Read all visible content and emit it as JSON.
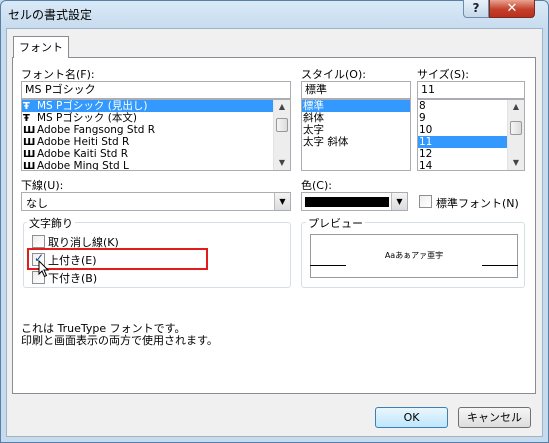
{
  "window": {
    "title": "セルの書式設定",
    "help_label": "?",
    "close_label": "✕"
  },
  "tabs": [
    {
      "label": "フォント"
    }
  ],
  "font_name": {
    "label": "フォント名(F):",
    "value": "MS Pゴシック",
    "items": [
      {
        "label": "MS Pゴシック (見出し)",
        "icon": "truetype-icon",
        "glyph": "Ŧ",
        "selected": true
      },
      {
        "label": "MS Pゴシック (本文)",
        "icon": "truetype-icon",
        "glyph": "Ŧ",
        "selected": false
      },
      {
        "label": "Adobe Fangsong Std R",
        "icon": "opentype-font-icon",
        "glyph": "Ш",
        "selected": false
      },
      {
        "label": "Adobe Heiti Std R",
        "icon": "opentype-font-icon",
        "glyph": "Ш",
        "selected": false
      },
      {
        "label": "Adobe Kaiti Std R",
        "icon": "opentype-font-icon",
        "glyph": "Ш",
        "selected": false
      },
      {
        "label": "Adobe Ming Std L",
        "icon": "opentype-font-icon",
        "glyph": "Ш",
        "selected": false
      }
    ]
  },
  "font_style": {
    "label": "スタイル(O):",
    "value": "標準",
    "items": [
      {
        "label": "標準",
        "selected": true
      },
      {
        "label": "斜体",
        "selected": false
      },
      {
        "label": "太字",
        "selected": false
      },
      {
        "label": "太字 斜体",
        "selected": false
      }
    ]
  },
  "font_size": {
    "label": "サイズ(S):",
    "value": "11",
    "items": [
      {
        "label": "8",
        "selected": false
      },
      {
        "label": "9",
        "selected": false
      },
      {
        "label": "10",
        "selected": false
      },
      {
        "label": "11",
        "selected": true
      },
      {
        "label": "12",
        "selected": false
      },
      {
        "label": "14",
        "selected": false
      }
    ]
  },
  "underline": {
    "label": "下線(U):",
    "value": "なし"
  },
  "color": {
    "label": "色(C):",
    "swatch": "#000000"
  },
  "normal_font": {
    "label": "標準フォント(N)",
    "checked": false
  },
  "effects": {
    "title": "文字飾り",
    "strikethrough": {
      "label": "取り消し線(K)",
      "checked": false
    },
    "superscript": {
      "label": "上付き(E)",
      "checked": true
    },
    "subscript": {
      "label": "下付き(B)",
      "checked": false
    }
  },
  "preview": {
    "title": "プレビュー",
    "sample": "Aaあぁアァ亜宇"
  },
  "info": {
    "line1": "これは TrueType フォントです。",
    "line2": "印刷と画面表示の両方で使用されます。"
  },
  "buttons": {
    "ok": "OK",
    "cancel": "キャンセル"
  },
  "colors": {
    "selection": "#3399ff",
    "highlight_box": "#e21b1b"
  }
}
